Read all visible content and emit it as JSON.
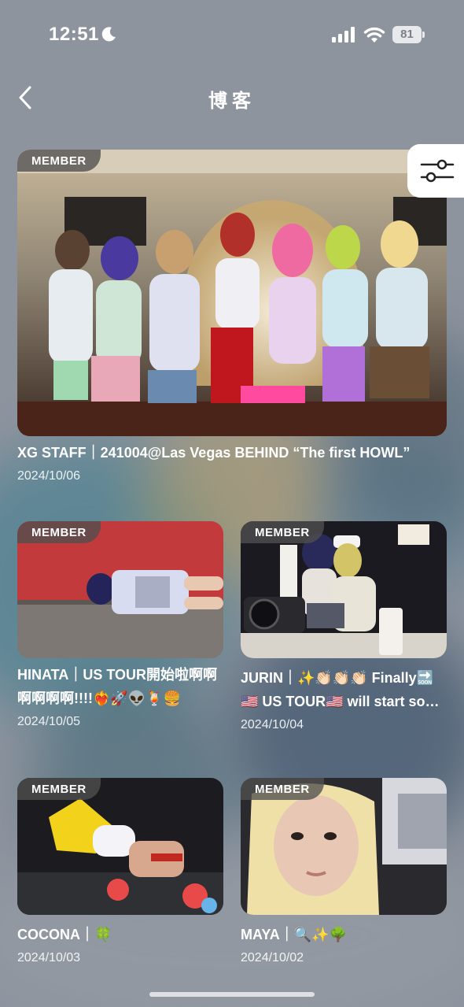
{
  "status_bar": {
    "time": "12:51",
    "battery": "81"
  },
  "header": {
    "title": "博客"
  },
  "posts": [
    {
      "badge": "MEMBER",
      "title": "XG STAFF｜241004@Las Vegas BEHIND “The first HOWL”",
      "date": "2024/10/06"
    },
    {
      "badge": "MEMBER",
      "title_line1": "HINATA｜US TOUR開始啦啊啊",
      "title_line2": "啊啊啊啊!!!!❤️‍🔥🚀👽🍹🍔",
      "date": "2024/10/05"
    },
    {
      "badge": "MEMBER",
      "title_line1": "JURIN｜✨👏🏻👏🏻👏🏻 Finally🔜",
      "title_line2": "🇺🇸 US TOUR🇺🇸 will start soon...",
      "date": "2024/10/04"
    },
    {
      "badge": "MEMBER",
      "title": "COCONA｜🍀",
      "date": "2024/10/03"
    },
    {
      "badge": "MEMBER",
      "title": "MAYA｜🔍✨🌳",
      "date": "2024/10/02"
    }
  ]
}
